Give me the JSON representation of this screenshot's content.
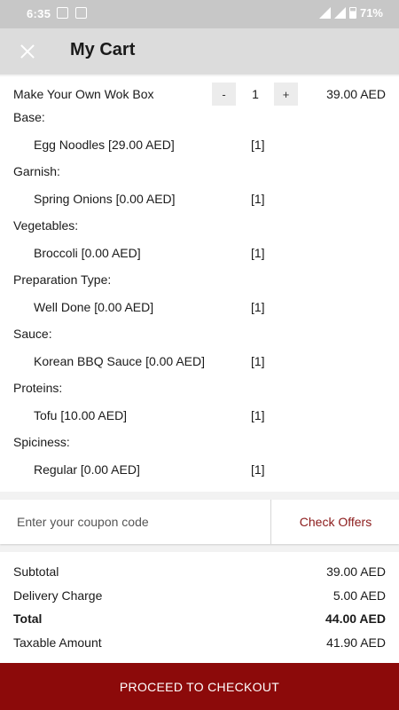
{
  "status_bar": {
    "time": "6:35",
    "battery": "71%"
  },
  "header": {
    "title": "My Cart"
  },
  "cart": {
    "item": {
      "name": "Make Your Own Wok Box",
      "minus": "-",
      "qty": "1",
      "plus": "+",
      "price": "39.00 AED"
    },
    "options": [
      {
        "label": "Base:",
        "value": "Egg Noodles [29.00 AED]",
        "qty": "[1]"
      },
      {
        "label": "Garnish:",
        "value": "Spring Onions [0.00 AED]",
        "qty": "[1]"
      },
      {
        "label": "Vegetables:",
        "value": "Broccoli [0.00 AED]",
        "qty": "[1]"
      },
      {
        "label": "Preparation Type:",
        "value": "Well Done [0.00 AED]",
        "qty": "[1]"
      },
      {
        "label": "Sauce:",
        "value": "Korean BBQ Sauce [0.00 AED]",
        "qty": "[1]"
      },
      {
        "label": "Proteins:",
        "value": "Tofu [10.00 AED]",
        "qty": "[1]"
      },
      {
        "label": "Spiciness:",
        "value": "Regular [0.00 AED]",
        "qty": "[1]"
      }
    ]
  },
  "coupon": {
    "placeholder": "Enter your coupon code",
    "check_offers": "Check Offers"
  },
  "summary": {
    "subtotal_label": "Subtotal",
    "subtotal": "39.00 AED",
    "delivery_label": "Delivery Charge",
    "delivery": "5.00 AED",
    "total_label": "Total",
    "total": "44.00 AED",
    "taxable_label": "Taxable Amount",
    "taxable": "41.90 AED"
  },
  "checkout_label": "PROCEED TO CHECKOUT",
  "colors": {
    "accent": "#8c0a0a",
    "offers_text": "#8b1a1a",
    "header_bg": "#dcdcdc"
  }
}
